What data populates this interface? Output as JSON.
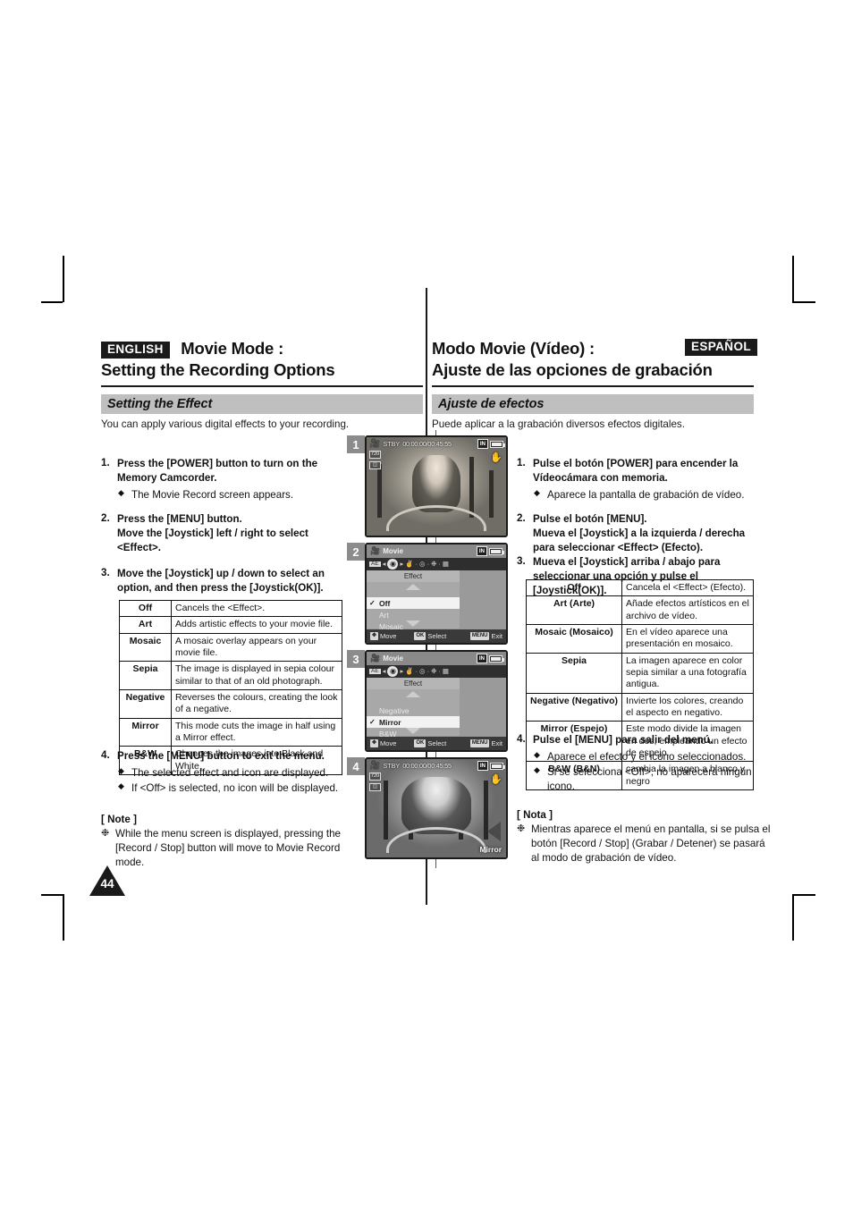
{
  "page": {
    "number": "44"
  },
  "english": {
    "badge": "ENGLISH",
    "title_line1": "Movie Mode :",
    "title_line2": "Setting the Recording Options",
    "section_title": "Setting the Effect",
    "section_intro": "You can apply various digital effects to your recording.",
    "steps": [
      {
        "num": "1.",
        "text": "Press the [POWER] button to turn on the Memory Camcorder.",
        "bullets": [
          "The Movie Record screen appears."
        ]
      },
      {
        "num": "2.",
        "text": "Press the [MENU] button.\nMove the [Joystick] left / right to select <Effect>.",
        "bullets": []
      },
      {
        "num": "3.",
        "text": "Move the [Joystick] up / down to select an option, and then press the [Joystick(OK)].",
        "bullets": []
      },
      {
        "num": "4.",
        "text": "Press the [MENU] button to exit the menu.",
        "bullets": [
          "The selected effect and icon are displayed.",
          "If <Off> is selected, no icon will be displayed."
        ]
      }
    ],
    "table": [
      {
        "key": "Off",
        "value": "Cancels the <Effect>."
      },
      {
        "key": "Art",
        "value": "Adds artistic effects to your movie file."
      },
      {
        "key": "Mosaic",
        "value": "A mosaic overlay appears on your movie file."
      },
      {
        "key": "Sepia",
        "value": "The image is displayed in sepia colour similar to that of an old photograph."
      },
      {
        "key": "Negative",
        "value": "Reverses the colours, creating the look of a negative."
      },
      {
        "key": "Mirror",
        "value": "This mode cuts the image in half using a Mirror effect."
      },
      {
        "key": "B&W",
        "value": "Changes the images into Black and White."
      }
    ],
    "note_title": "[ Note ]",
    "notes": [
      "While the menu screen is displayed, pressing the [Record / Stop] button will move to Movie Record mode."
    ]
  },
  "spanish": {
    "badge": "ESPAÑOL",
    "title_line1": "Modo Movie (Vídeo) :",
    "title_line2": "Ajuste de las opciones de grabación",
    "section_title": "Ajuste de efectos",
    "section_intro": "Puede aplicar a la grabación diversos efectos digitales.",
    "steps": [
      {
        "num": "1.",
        "text": "Pulse el botón [POWER] para encender la Vídeocámara con memoria.",
        "bullets": [
          "Aparece la pantalla de grabación de vídeo."
        ]
      },
      {
        "num": "2.",
        "text": "Pulse el botón [MENU].\nMueva el [Joystick] a la izquierda / derecha para seleccionar <Effect> (Efecto).",
        "bullets": []
      },
      {
        "num": "3.",
        "text": "Mueva el [Joystick] arriba / abajo para seleccionar una opción y pulse el [Joystick(OK)].",
        "bullets": []
      },
      {
        "num": "4.",
        "text": "Pulse el [MENU] para salir del menú.",
        "bullets": [
          "Aparece el efecto y el icono seleccionados.",
          "Si se selecciona <Off>, no aparecerá ningún icono."
        ]
      }
    ],
    "table": [
      {
        "key": "Off",
        "value": "Cancela el <Effect> (Efecto)."
      },
      {
        "key": "Art (Arte)",
        "value": "Añade efectos artísticos en el archivo de vídeo."
      },
      {
        "key": "Mosaic (Mosaico)",
        "value": "En el vídeo aparece una presentación en mosaico."
      },
      {
        "key": "Sepia",
        "value": "La imagen aparece en color sepia similar a una fotografía antigua."
      },
      {
        "key": "Negative (Negativo)",
        "value": "Invierte los colores, creando el aspecto en negativo."
      },
      {
        "key": "Mirror (Espejo)",
        "value": "Este modo divide la imagen en dos, empleando un efecto de espejo."
      },
      {
        "key": "B&W (B&N)",
        "value": "cambia la imagen a blanco y negro"
      }
    ],
    "note_title": "[ Nota ]",
    "notes": [
      "Mientras aparece el menú en pantalla, si se pulsa el botón [Record / Stop] (Grabar / Detener) se pasará al modo de grabación de vídeo."
    ]
  },
  "lcd_panels": [
    {
      "step": "1",
      "type": "photo",
      "osd": {
        "mode": "movie-record",
        "status": "STBY",
        "timecode": "00:00:00/00:45:55",
        "storage": "IN",
        "battery": "full",
        "quality_badge": "720",
        "icons": [
          "anti-shake-hand",
          "quality",
          "widescreen"
        ]
      }
    },
    {
      "step": "2",
      "type": "menu",
      "menu": {
        "title": "Movie",
        "caption": "Effect",
        "options": [
          {
            "label": "Off",
            "selected": true
          },
          {
            "label": "Art",
            "selected": false
          },
          {
            "label": "Mosaic",
            "selected": false
          }
        ],
        "footer": {
          "move_key": "✥",
          "move_label": "Move",
          "select_key": "OK",
          "select_label": "Select",
          "exit_key": "MENU",
          "exit_label": "Exit"
        }
      }
    },
    {
      "step": "3",
      "type": "menu",
      "menu": {
        "title": "Movie",
        "caption": "Effect",
        "options": [
          {
            "label": "Negative",
            "selected": false
          },
          {
            "label": "Mirror",
            "selected": true
          },
          {
            "label": "B&W",
            "selected": false
          }
        ],
        "footer": {
          "move_key": "✥",
          "move_label": "Move",
          "select_key": "OK",
          "select_label": "Select",
          "exit_key": "MENU",
          "exit_label": "Exit"
        }
      }
    },
    {
      "step": "4",
      "type": "photo",
      "osd": {
        "mode": "movie-record",
        "status": "STBY",
        "timecode": "00:00:00/00:45:55",
        "storage": "IN",
        "battery": "full",
        "effect_label": "Mirror",
        "quality_badge": "720"
      }
    }
  ]
}
